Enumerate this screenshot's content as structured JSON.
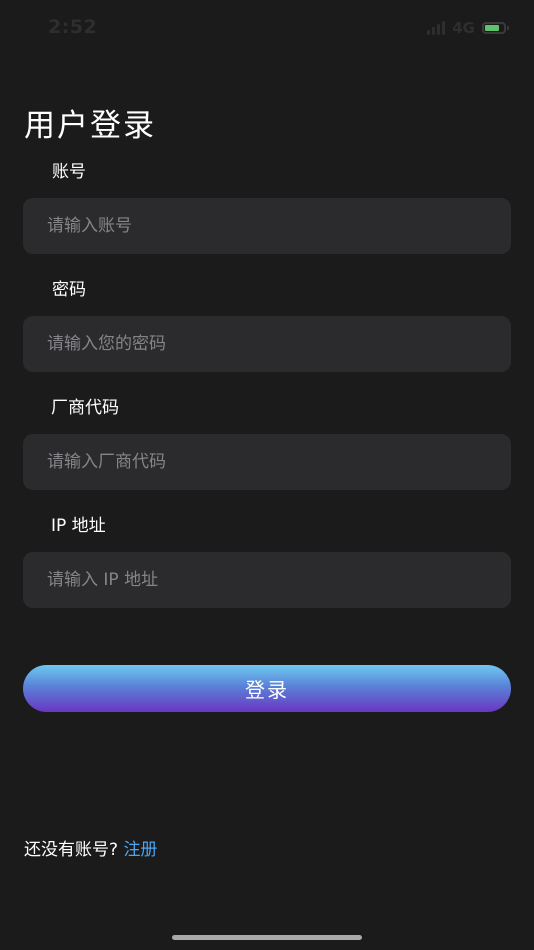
{
  "status_bar": {
    "time": "2:52",
    "network": "4G",
    "icons": [
      "signal-icon",
      "battery-icon"
    ],
    "battery_color": "#5fc26d"
  },
  "page": {
    "title": "用户登录"
  },
  "form": {
    "account": {
      "label": "账号",
      "placeholder": "请输入账号",
      "value": ""
    },
    "password": {
      "label": "密码",
      "placeholder": "请输入您的密码",
      "value": ""
    },
    "vendor_code": {
      "label": "厂商代码",
      "placeholder": "请输入厂商代码",
      "value": ""
    },
    "ip_address": {
      "label": "IP 地址",
      "placeholder": "请输入 IP 地址",
      "value": ""
    }
  },
  "login_button": {
    "label": "登录",
    "gradient": [
      "#6fc8f0",
      "#5a82d8",
      "#6a36c2"
    ]
  },
  "register": {
    "prompt": "还没有账号?",
    "link": "注册",
    "link_color": "#4ba6f2"
  },
  "theme": {
    "background": "#1b1b1c",
    "input_background": "#2b2b2d",
    "placeholder_color": "#858589"
  }
}
